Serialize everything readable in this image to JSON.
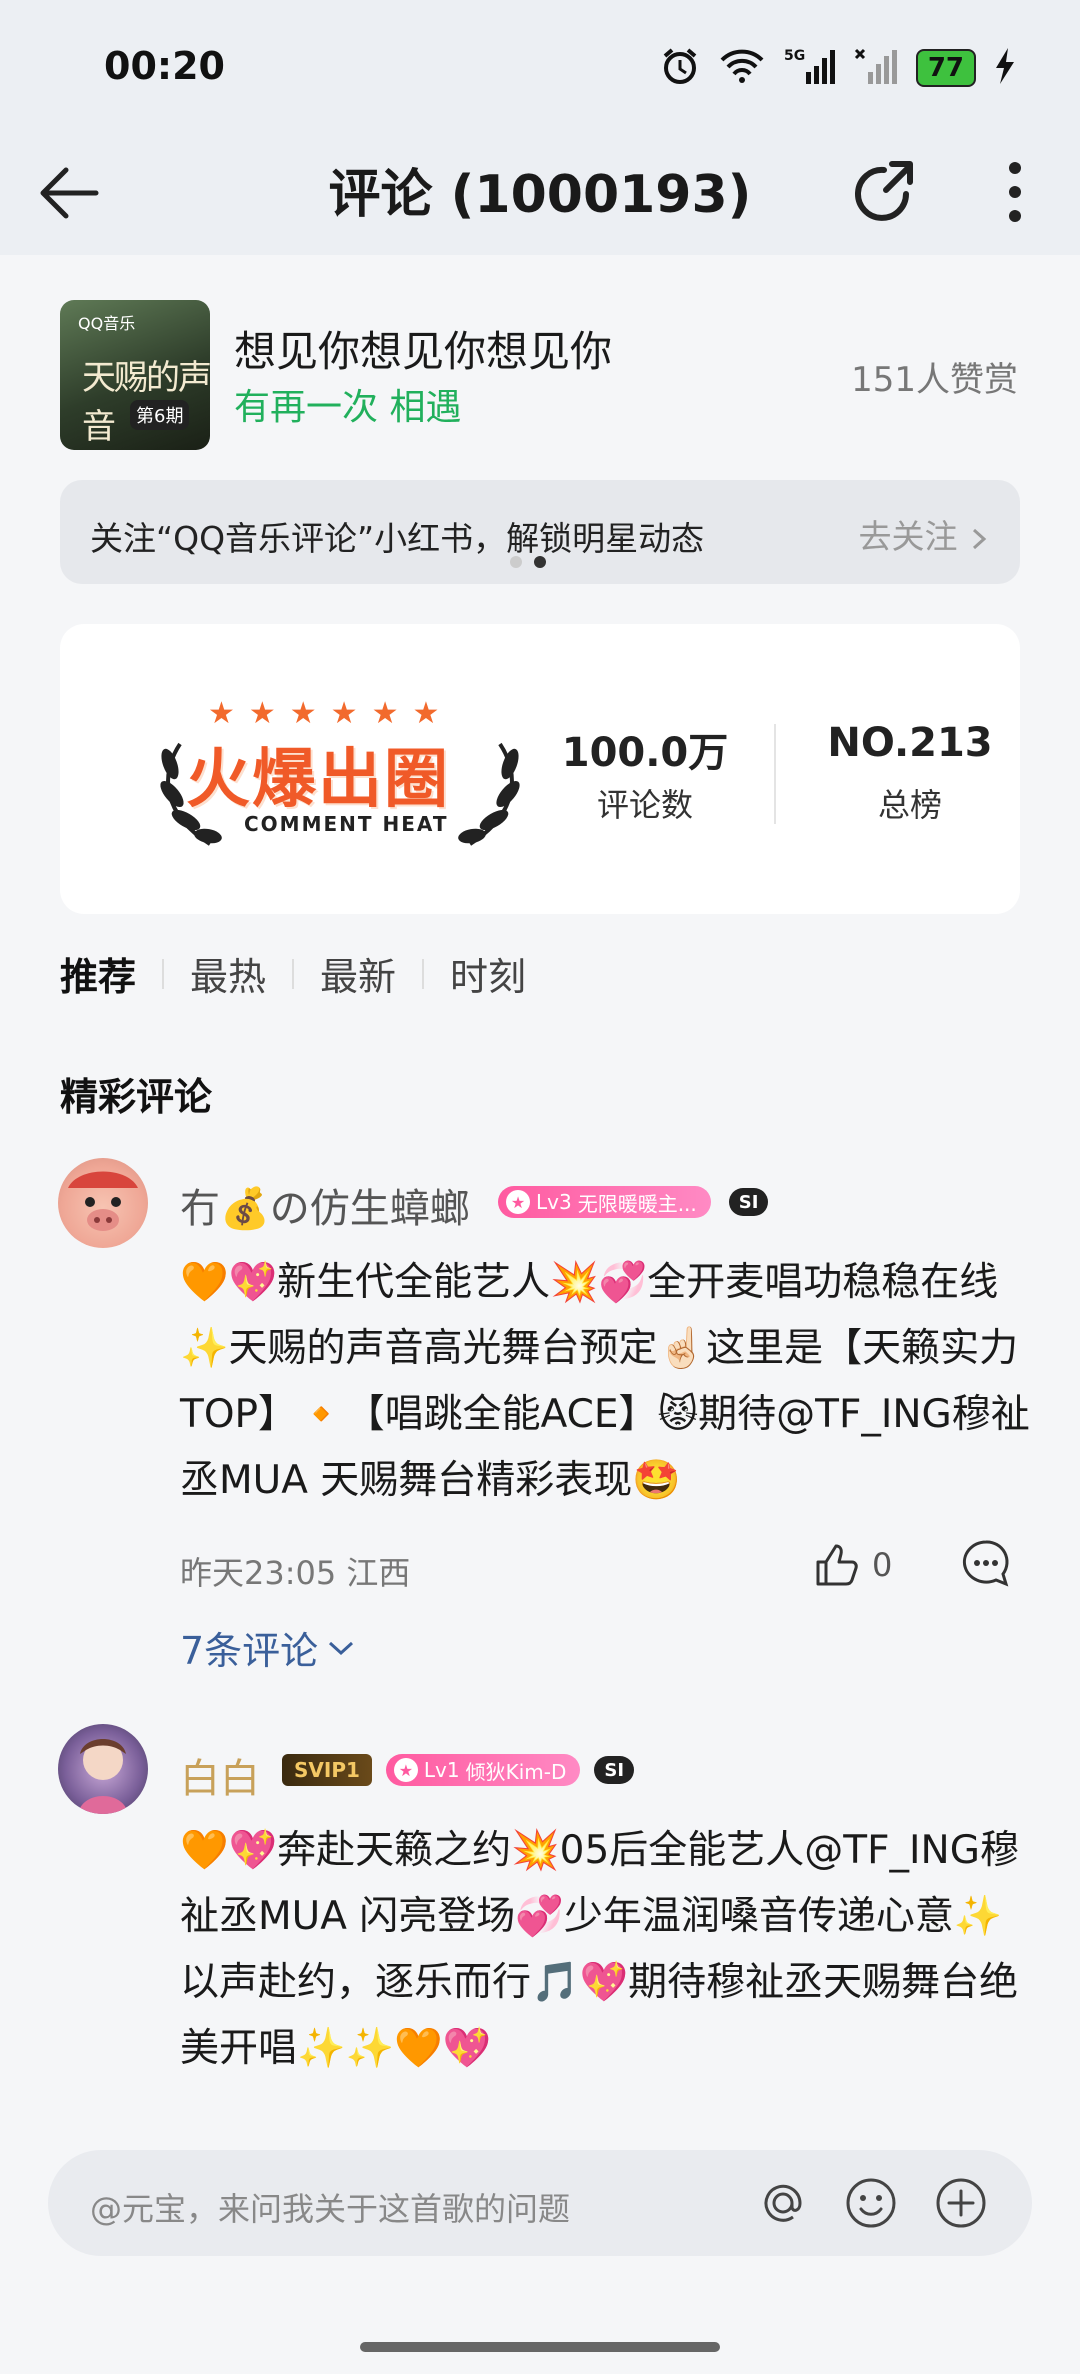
{
  "status_bar": {
    "time": "00:20",
    "battery": "77"
  },
  "header": {
    "title": "评论 (1000193)"
  },
  "song": {
    "title": "想见你想见你想见你",
    "artist": "有再一次 相遇",
    "likes": "151人赞赏",
    "cover_logo": "QQ音乐",
    "cover_title": "天赐的声音",
    "cover_sub": "第6期"
  },
  "banner": {
    "text": "关注“QQ音乐评论”小红书，解锁明星动态",
    "action": "去关注"
  },
  "heat": {
    "stars": "★★★★★★",
    "title": "火爆出圈",
    "subtitle": "COMMENT HEAT",
    "stat1_value": "100.0万",
    "stat1_label": "评论数",
    "stat2_value": "NO.213",
    "stat2_label": "总榜"
  },
  "tabs": [
    {
      "label": "推荐"
    },
    {
      "label": "最热"
    },
    {
      "label": "最新"
    },
    {
      "label": "时刻"
    }
  ],
  "section_title": "精彩评论",
  "comments": [
    {
      "name": "冇💰の仿生蟑螂",
      "level": "Lv3",
      "level_text": "无限暖暖主...",
      "si": "SI",
      "text": "🧡💖新生代全能艺人💥💞全开麦唱功稳稳在线✨天赐的声音高光舞台预定☝🏻这里是【天籁实力TOP】🔸【唱跳全能ACE】😾期待@TF_ING穆祉丞MUA 天赐舞台精彩表现🤩",
      "meta": "昨天23:05 江西",
      "like_count": "0",
      "replies": "7条评论"
    },
    {
      "name": "白白",
      "svip": "SVIP1",
      "level": "Lv1",
      "level_text": "倾狄Kim-D",
      "si": "SI",
      "text": "🧡💖奔赴天籁之约💥05后全能艺人@TF_ING穆祉丞MUA 闪亮登场💞少年温润嗓音传递心意✨以声赴约，逐乐而行🎵💖期待穆祉丞天赐舞台绝美开唱✨✨🧡💖"
    }
  ],
  "input": {
    "placeholder": "@元宝，来问我关于这首歌的问题"
  },
  "colors": {
    "accent_green": "#21b05c",
    "heat_orange": "#f05a28",
    "link_blue": "#3a5f9a"
  }
}
